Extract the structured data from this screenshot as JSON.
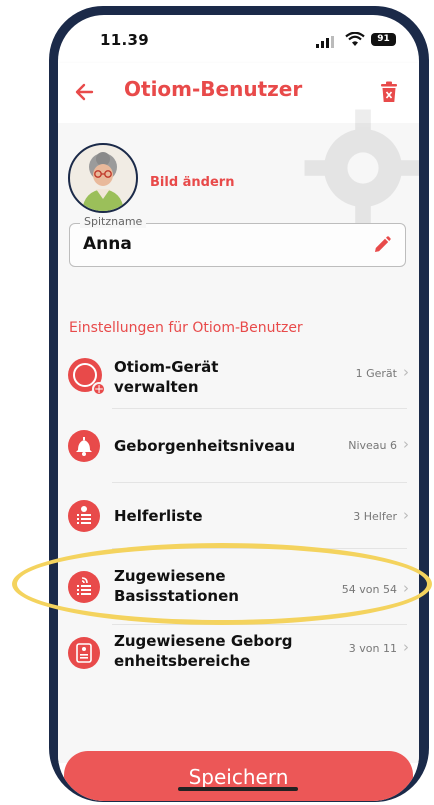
{
  "status_bar": {
    "time": "11.39",
    "battery": "91"
  },
  "header": {
    "title": "Otiom-Benutzer"
  },
  "profile": {
    "change_photo": "Bild ändern"
  },
  "nickname": {
    "label": "Spitzname",
    "value": "Anna"
  },
  "settings": {
    "section_title": "Einstellungen für Otiom-Benutzer",
    "items": [
      {
        "label": "Otiom-Gerät verwalten",
        "value": "1 Gerät",
        "icon": "device-icon"
      },
      {
        "label": "Geborgenheitsniveau",
        "value": "Niveau 6",
        "icon": "bell-icon"
      },
      {
        "label": "Helferliste",
        "value": "3 Helfer",
        "icon": "helper-list-icon"
      },
      {
        "label": "Zugewiesene Basisstationen",
        "value": "54 von 54",
        "icon": "base-station-icon"
      },
      {
        "label": "Zugewiesene Geborg enheitsbereiche",
        "value": "3 von 11",
        "icon": "safe-zone-icon"
      }
    ]
  },
  "footer": {
    "save_label": "Speichern"
  },
  "colors": {
    "accent": "#e84a4a",
    "highlight": "#f4d35e",
    "bezel": "#1b2a49"
  }
}
